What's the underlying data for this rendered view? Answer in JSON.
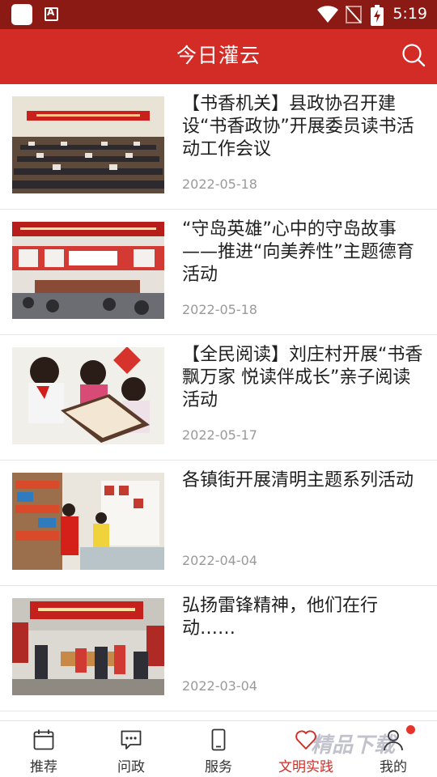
{
  "status_bar": {
    "time": "5:19",
    "colors": {
      "bar": "#8c1a14"
    }
  },
  "app_bar": {
    "title": "今日灌云",
    "background": "#d32b25"
  },
  "news": [
    {
      "title": "【书香机关】县政协召开建设“书香政协”开展委员读书活动工作会议",
      "date": "2022-05-18",
      "image": "meeting-hall-photo"
    },
    {
      "title": "“守岛英雄”心中的守岛故事——推进“向美养性”主题德育活动",
      "date": "2022-05-18",
      "image": "school-assembly-photo"
    },
    {
      "title": "【全民阅读】刘庄村开展“书香飘万家 悦读伴成长”亲子阅读活动",
      "date": "2022-05-17",
      "image": "children-reading-photo"
    },
    {
      "title": "各镇街开展清明主题系列活动",
      "date": "2022-04-04",
      "image": "shop-volunteers-photo"
    },
    {
      "title": "弘扬雷锋精神，他们在行动……",
      "date": "2022-03-04",
      "image": "outdoor-volunteer-photo"
    }
  ],
  "bottom_nav": [
    {
      "label": "推荐",
      "icon": "calendar-icon",
      "active": false
    },
    {
      "label": "问政",
      "icon": "chat-bubble-icon",
      "active": false
    },
    {
      "label": "服务",
      "icon": "phone-icon",
      "active": false
    },
    {
      "label": "文明实践",
      "icon": "heart-icon",
      "active": true
    },
    {
      "label": "我的",
      "icon": "person-icon",
      "active": false
    }
  ],
  "accent_color": "#d32b25",
  "watermark": "精品下载"
}
